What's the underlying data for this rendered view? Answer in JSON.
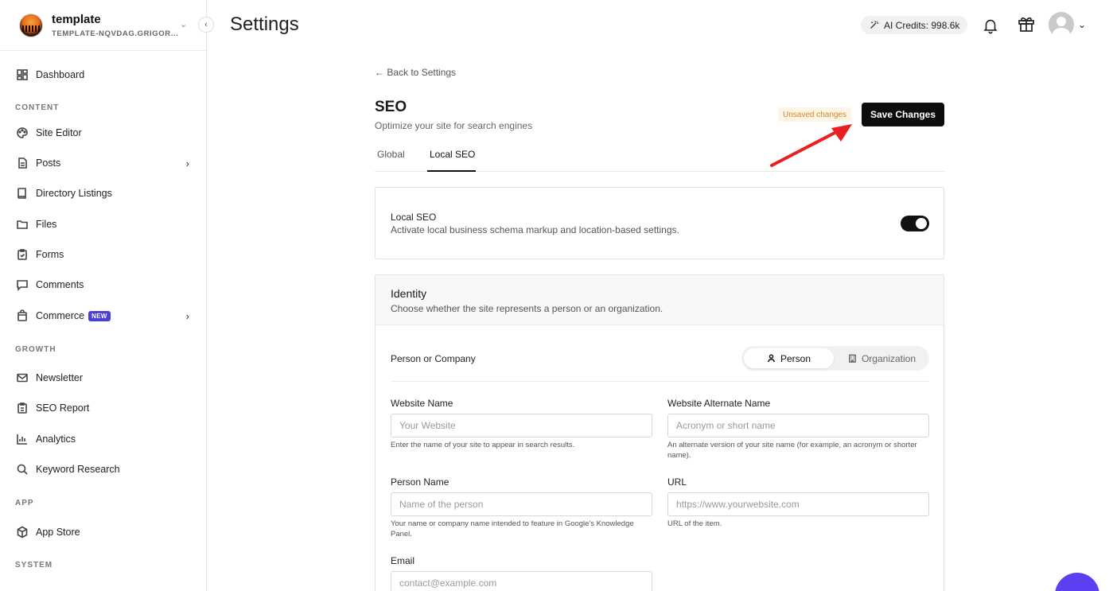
{
  "site": {
    "name": "template",
    "subdomain": "TEMPLATE-NQVDAG.GRIGOR..."
  },
  "sidebar": {
    "dashboard": "Dashboard",
    "sections": {
      "content": "CONTENT",
      "growth": "GROWTH",
      "app": "APP",
      "system": "SYSTEM"
    },
    "items": {
      "site_editor": "Site Editor",
      "posts": "Posts",
      "directory": "Directory Listings",
      "files": "Files",
      "forms": "Forms",
      "comments": "Comments",
      "commerce": "Commerce",
      "commerce_badge": "NEW",
      "newsletter": "Newsletter",
      "seo_report": "SEO Report",
      "analytics": "Analytics",
      "keyword_research": "Keyword Research",
      "app_store": "App Store"
    }
  },
  "header": {
    "title": "Settings",
    "credits": "AI Credits: 998.6k"
  },
  "content": {
    "back": "← Back to Settings",
    "title": "SEO",
    "subtitle": "Optimize your site for search engines",
    "unsaved": "Unsaved changes",
    "save": "Save Changes",
    "tabs": {
      "global": "Global",
      "local": "Local SEO"
    },
    "local_seo": {
      "label": "Local SEO",
      "desc": "Activate local business schema markup and location-based settings.",
      "enabled": true
    },
    "identity": {
      "title": "Identity",
      "desc": "Choose whether the site represents a person or an organization.",
      "poc_label": "Person or Company",
      "opt_person": "Person",
      "opt_org": "Organization",
      "selected": "Person"
    },
    "fields": {
      "website_name": {
        "label": "Website Name",
        "placeholder": "Your Website",
        "value": "",
        "help": "Enter the name of your site to appear in search results."
      },
      "website_alt": {
        "label": "Website Alternate Name",
        "placeholder": "Acronym or short name",
        "value": "",
        "help": "An alternate version of your site name (for example, an acronym or shorter name)."
      },
      "person_name": {
        "label": "Person Name",
        "placeholder": "Name of the person",
        "value": "",
        "help": "Your name or company name intended to feature in Google's Knowledge Panel."
      },
      "url": {
        "label": "URL",
        "placeholder": "https://www.yourwebsite.com",
        "value": "",
        "help": "URL of the item."
      },
      "email": {
        "label": "Email",
        "placeholder": "contact@example.com",
        "value": ""
      }
    }
  },
  "colors": {
    "accent": "#0d0d0d",
    "unsaved": "#d2871e",
    "badge": "#4b3fd6",
    "annotation": "#e8201f",
    "chat": "#5b3ff0"
  }
}
